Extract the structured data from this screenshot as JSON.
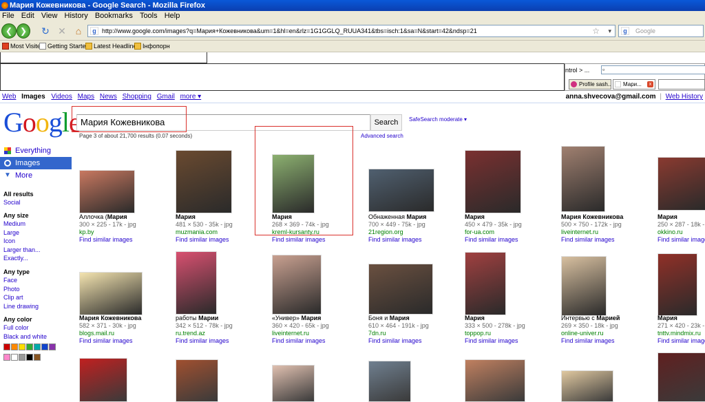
{
  "window": {
    "title": "Мария Кожевникова - Google Search - Mozilla Firefox"
  },
  "menu": [
    "File",
    "Edit",
    "View",
    "History",
    "Bookmarks",
    "Tools",
    "Help"
  ],
  "url": "http://www.google.com/images?q=Мария+Кожевникова&um=1&hl=en&rlz=1G1GGLQ_RUUA341&tbs=isch:1&sa=N&start=42&ndsp=21",
  "search_box_placeholder": "Google",
  "bookmarks": [
    "Most Visited",
    "Getting Started",
    "Latest Headlines",
    "Інфопорн"
  ],
  "panel": {
    "ctrl_text": "ntrol > ..."
  },
  "tabs": [
    "Profile sash...",
    "Мари..."
  ],
  "gbar": {
    "links": [
      "Web",
      "Images",
      "Videos",
      "Maps",
      "News",
      "Shopping",
      "Gmail",
      "more ▾"
    ],
    "current": "Images",
    "email": "anna.shvecova@gmail.com",
    "separator": "|",
    "history": "Web History"
  },
  "logo": [
    "G",
    "o",
    "o",
    "g",
    "l",
    "e"
  ],
  "query": "Мария Кожевникова",
  "search_button": "Search",
  "safesearch": "SafeSearch moderate ▾",
  "result_info": "Page 3 of about 21,700 results (0.07 seconds)",
  "advanced_search": "Advanced search",
  "sidebar": {
    "modes": [
      {
        "label": "Everything",
        "selected": false
      },
      {
        "label": "Images",
        "selected": true
      },
      {
        "label": "More",
        "selected": false
      }
    ],
    "all_results": "All results",
    "social": "Social",
    "size_head": "Any size",
    "sizes": [
      "Medium",
      "Large",
      "Icon",
      "Larger than...",
      "Exactly..."
    ],
    "type_head": "Any type",
    "types": [
      "Face",
      "Photo",
      "Clip art",
      "Line drawing"
    ],
    "color_head": "Any color",
    "colors": [
      "Full color",
      "Black and white"
    ],
    "swatches": [
      "#cc0000",
      "#ff8800",
      "#ffdd00",
      "#33aa33",
      "#00aaaa",
      "#1144cc",
      "#8833aa",
      "#ff88cc",
      "#ffffff",
      "#999999",
      "#000000",
      "#885522"
    ]
  },
  "results": [
    {
      "title_pre": "Аллочка (",
      "title_bold": "Мария",
      "title_post": "",
      "meta": "300 × 225 - 17k - jpg",
      "site": "kp.by",
      "similar": "Find similar images",
      "color": "#c87860"
    },
    {
      "title_pre": "",
      "title_bold": "Мария",
      "title_post": "",
      "meta": "481 × 530 - 35k - jpg",
      "site": "muzmania.com",
      "similar": "Find similar images",
      "color": "#6a4a30"
    },
    {
      "title_pre": "",
      "title_bold": "Мария",
      "title_post": "",
      "meta": "268 × 369 - 74k - jpg",
      "site": "kreml-kursanty.ru",
      "similar": "Find similar images",
      "color": "#8cb070"
    },
    {
      "title_pre": "Обнаженная ",
      "title_bold": "Мария",
      "title_post": "",
      "meta": "700 × 449 - 75k - jpg",
      "site": "21region.org",
      "similar": "Find similar images",
      "color": "#506070"
    },
    {
      "title_pre": "",
      "title_bold": "Мария",
      "title_post": "",
      "meta": "450 × 479 - 35k - jpg",
      "site": "for-ua.com",
      "similar": "Find similar images",
      "color": "#7a3030"
    },
    {
      "title_pre": "",
      "title_bold": "Мария Кожевникова",
      "title_post": "",
      "meta": "500 × 750 - 172k - jpg",
      "site": "liveinternet.ru",
      "similar": "Find similar images",
      "color": "#a08070"
    },
    {
      "title_pre": "",
      "title_bold": "Мария",
      "title_post": "",
      "meta": "250 × 287 - 18k - jpg",
      "site": "okkino.ru",
      "similar": "Find similar images",
      "color": "#8a3a30"
    },
    {
      "title_pre": "",
      "title_bold": "Мария Кожевникова",
      "title_post": "",
      "meta": "582 × 371 - 30k - jpg",
      "site": "blogs.mail.ru",
      "similar": "Find similar images",
      "color": "#f4e4b0"
    },
    {
      "title_pre": "работы ",
      "title_bold": "Марии",
      "title_post": "",
      "meta": "342 × 512 - 78k - jpg",
      "site": "ru.trend.az",
      "similar": "Find similar images",
      "color": "#d85070"
    },
    {
      "title_pre": "«Универ» ",
      "title_bold": "Мария",
      "title_post": "",
      "meta": "360 × 420 - 65k - jpg",
      "site": "liveinternet.ru",
      "similar": "Find similar images",
      "color": "#c8a090"
    },
    {
      "title_pre": "Боня и ",
      "title_bold": "Мария",
      "title_post": "",
      "meta": "610 × 464 - 191k - jpg",
      "site": "7dn.ru",
      "similar": "Find similar images",
      "color": "#6a5040"
    },
    {
      "title_pre": "",
      "title_bold": "Мария",
      "title_post": "",
      "meta": "333 × 500 - 278k - jpg",
      "site": "toppop.ru",
      "similar": "Find similar images",
      "color": "#a04040"
    },
    {
      "title_pre": "Интервью с ",
      "title_bold": "Марией",
      "title_post": "",
      "meta": "269 × 350 - 18k - jpg",
      "site": "online-univer.ru",
      "similar": "Find similar images",
      "color": "#d8c0a0"
    },
    {
      "title_pre": "",
      "title_bold": "Мария",
      "title_post": "",
      "meta": "271 × 420 - 23k - jpg",
      "site": "tnttv.mindmix.ru",
      "similar": "Find similar images",
      "color": "#903028"
    }
  ]
}
